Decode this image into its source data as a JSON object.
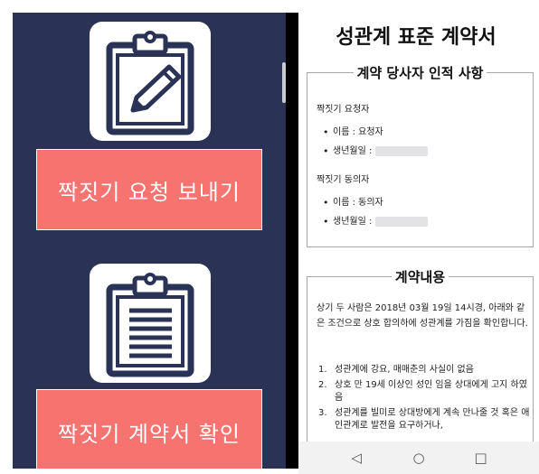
{
  "left": {
    "send_request_button": "짝짓기 요청 보내기",
    "check_contract_button": "짝짓기 계약서 확인",
    "icons": [
      "clipboard-pencil-icon",
      "clipboard-list-icon"
    ]
  },
  "document": {
    "title": "성관계 표준 계약서",
    "parties": {
      "legend": "계약 당사자 인적 사항",
      "requester_label": "짝짓기 요청자",
      "requester_name": "이름 : 요청자",
      "requester_birth": "생년월일 :",
      "consenter_label": "짝짓기 동의자",
      "consenter_name": "이름 : 동의자",
      "consenter_birth": "생년월일 :"
    },
    "content": {
      "legend": "계약내용",
      "intro": "상기 두 사람은 2018년 03월 19일 14시경, 아래와 같은 조건으로 상호 합의하에 성관계를 가짐을 확인합니다.",
      "items": [
        {
          "num": "1.",
          "text": "성관계에 강요, 매매춘의 사실이 없음"
        },
        {
          "num": "2.",
          "text": "상호 만 19세 이상인 성인 임을 상대에게 고지 하였음"
        },
        {
          "num": "3.",
          "text": "성관계를 빌미로 상대방에게 계속 만나줄 것 혹은 애인관계로 발전을 요구하거나,"
        }
      ]
    }
  },
  "navbar": {
    "back": "◁",
    "home": "○",
    "recents": "□"
  },
  "colors": {
    "panel": "#2a3355",
    "button": "#f7736f",
    "divider": "#000000"
  }
}
